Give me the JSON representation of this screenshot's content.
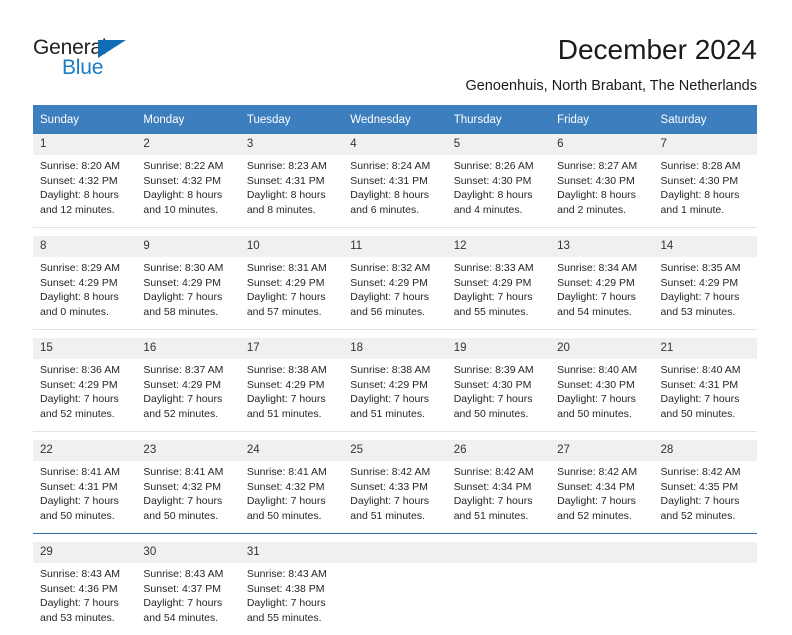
{
  "brand": {
    "name_dark": "General",
    "name_blue": "Blue",
    "accent_blue": "#1a7dc4",
    "triangle_blue": "#0f6cb5"
  },
  "header": {
    "title": "December 2024",
    "subtitle": "Genoenhuis, North Brabant, The Netherlands"
  },
  "calendar": {
    "header_bg": "#3d7ebf",
    "daynum_bg": "#f0f0f0",
    "weekdays": [
      "Sunday",
      "Monday",
      "Tuesday",
      "Wednesday",
      "Thursday",
      "Friday",
      "Saturday"
    ],
    "weeks": [
      {
        "days": [
          {
            "num": "1",
            "sunrise": "Sunrise: 8:20 AM",
            "sunset": "Sunset: 4:32 PM",
            "daylight1": "Daylight: 8 hours",
            "daylight2": "and 12 minutes."
          },
          {
            "num": "2",
            "sunrise": "Sunrise: 8:22 AM",
            "sunset": "Sunset: 4:32 PM",
            "daylight1": "Daylight: 8 hours",
            "daylight2": "and 10 minutes."
          },
          {
            "num": "3",
            "sunrise": "Sunrise: 8:23 AM",
            "sunset": "Sunset: 4:31 PM",
            "daylight1": "Daylight: 8 hours",
            "daylight2": "and 8 minutes."
          },
          {
            "num": "4",
            "sunrise": "Sunrise: 8:24 AM",
            "sunset": "Sunset: 4:31 PM",
            "daylight1": "Daylight: 8 hours",
            "daylight2": "and 6 minutes."
          },
          {
            "num": "5",
            "sunrise": "Sunrise: 8:26 AM",
            "sunset": "Sunset: 4:30 PM",
            "daylight1": "Daylight: 8 hours",
            "daylight2": "and 4 minutes."
          },
          {
            "num": "6",
            "sunrise": "Sunrise: 8:27 AM",
            "sunset": "Sunset: 4:30 PM",
            "daylight1": "Daylight: 8 hours",
            "daylight2": "and 2 minutes."
          },
          {
            "num": "7",
            "sunrise": "Sunrise: 8:28 AM",
            "sunset": "Sunset: 4:30 PM",
            "daylight1": "Daylight: 8 hours",
            "daylight2": "and 1 minute."
          }
        ]
      },
      {
        "days": [
          {
            "num": "8",
            "sunrise": "Sunrise: 8:29 AM",
            "sunset": "Sunset: 4:29 PM",
            "daylight1": "Daylight: 8 hours",
            "daylight2": "and 0 minutes."
          },
          {
            "num": "9",
            "sunrise": "Sunrise: 8:30 AM",
            "sunset": "Sunset: 4:29 PM",
            "daylight1": "Daylight: 7 hours",
            "daylight2": "and 58 minutes."
          },
          {
            "num": "10",
            "sunrise": "Sunrise: 8:31 AM",
            "sunset": "Sunset: 4:29 PM",
            "daylight1": "Daylight: 7 hours",
            "daylight2": "and 57 minutes."
          },
          {
            "num": "11",
            "sunrise": "Sunrise: 8:32 AM",
            "sunset": "Sunset: 4:29 PM",
            "daylight1": "Daylight: 7 hours",
            "daylight2": "and 56 minutes."
          },
          {
            "num": "12",
            "sunrise": "Sunrise: 8:33 AM",
            "sunset": "Sunset: 4:29 PM",
            "daylight1": "Daylight: 7 hours",
            "daylight2": "and 55 minutes."
          },
          {
            "num": "13",
            "sunrise": "Sunrise: 8:34 AM",
            "sunset": "Sunset: 4:29 PM",
            "daylight1": "Daylight: 7 hours",
            "daylight2": "and 54 minutes."
          },
          {
            "num": "14",
            "sunrise": "Sunrise: 8:35 AM",
            "sunset": "Sunset: 4:29 PM",
            "daylight1": "Daylight: 7 hours",
            "daylight2": "and 53 minutes."
          }
        ]
      },
      {
        "days": [
          {
            "num": "15",
            "sunrise": "Sunrise: 8:36 AM",
            "sunset": "Sunset: 4:29 PM",
            "daylight1": "Daylight: 7 hours",
            "daylight2": "and 52 minutes."
          },
          {
            "num": "16",
            "sunrise": "Sunrise: 8:37 AM",
            "sunset": "Sunset: 4:29 PM",
            "daylight1": "Daylight: 7 hours",
            "daylight2": "and 52 minutes."
          },
          {
            "num": "17",
            "sunrise": "Sunrise: 8:38 AM",
            "sunset": "Sunset: 4:29 PM",
            "daylight1": "Daylight: 7 hours",
            "daylight2": "and 51 minutes."
          },
          {
            "num": "18",
            "sunrise": "Sunrise: 8:38 AM",
            "sunset": "Sunset: 4:29 PM",
            "daylight1": "Daylight: 7 hours",
            "daylight2": "and 51 minutes."
          },
          {
            "num": "19",
            "sunrise": "Sunrise: 8:39 AM",
            "sunset": "Sunset: 4:30 PM",
            "daylight1": "Daylight: 7 hours",
            "daylight2": "and 50 minutes."
          },
          {
            "num": "20",
            "sunrise": "Sunrise: 8:40 AM",
            "sunset": "Sunset: 4:30 PM",
            "daylight1": "Daylight: 7 hours",
            "daylight2": "and 50 minutes."
          },
          {
            "num": "21",
            "sunrise": "Sunrise: 8:40 AM",
            "sunset": "Sunset: 4:31 PM",
            "daylight1": "Daylight: 7 hours",
            "daylight2": "and 50 minutes."
          }
        ]
      },
      {
        "days": [
          {
            "num": "22",
            "sunrise": "Sunrise: 8:41 AM",
            "sunset": "Sunset: 4:31 PM",
            "daylight1": "Daylight: 7 hours",
            "daylight2": "and 50 minutes."
          },
          {
            "num": "23",
            "sunrise": "Sunrise: 8:41 AM",
            "sunset": "Sunset: 4:32 PM",
            "daylight1": "Daylight: 7 hours",
            "daylight2": "and 50 minutes."
          },
          {
            "num": "24",
            "sunrise": "Sunrise: 8:41 AM",
            "sunset": "Sunset: 4:32 PM",
            "daylight1": "Daylight: 7 hours",
            "daylight2": "and 50 minutes."
          },
          {
            "num": "25",
            "sunrise": "Sunrise: 8:42 AM",
            "sunset": "Sunset: 4:33 PM",
            "daylight1": "Daylight: 7 hours",
            "daylight2": "and 51 minutes."
          },
          {
            "num": "26",
            "sunrise": "Sunrise: 8:42 AM",
            "sunset": "Sunset: 4:34 PM",
            "daylight1": "Daylight: 7 hours",
            "daylight2": "and 51 minutes."
          },
          {
            "num": "27",
            "sunrise": "Sunrise: 8:42 AM",
            "sunset": "Sunset: 4:34 PM",
            "daylight1": "Daylight: 7 hours",
            "daylight2": "and 52 minutes."
          },
          {
            "num": "28",
            "sunrise": "Sunrise: 8:42 AM",
            "sunset": "Sunset: 4:35 PM",
            "daylight1": "Daylight: 7 hours",
            "daylight2": "and 52 minutes."
          }
        ]
      },
      {
        "days": [
          {
            "num": "29",
            "sunrise": "Sunrise: 8:43 AM",
            "sunset": "Sunset: 4:36 PM",
            "daylight1": "Daylight: 7 hours",
            "daylight2": "and 53 minutes."
          },
          {
            "num": "30",
            "sunrise": "Sunrise: 8:43 AM",
            "sunset": "Sunset: 4:37 PM",
            "daylight1": "Daylight: 7 hours",
            "daylight2": "and 54 minutes."
          },
          {
            "num": "31",
            "sunrise": "Sunrise: 8:43 AM",
            "sunset": "Sunset: 4:38 PM",
            "daylight1": "Daylight: 7 hours",
            "daylight2": "and 55 minutes."
          },
          {
            "num": "",
            "sunrise": "",
            "sunset": "",
            "daylight1": "",
            "daylight2": ""
          },
          {
            "num": "",
            "sunrise": "",
            "sunset": "",
            "daylight1": "",
            "daylight2": ""
          },
          {
            "num": "",
            "sunrise": "",
            "sunset": "",
            "daylight1": "",
            "daylight2": ""
          },
          {
            "num": "",
            "sunrise": "",
            "sunset": "",
            "daylight1": "",
            "daylight2": ""
          }
        ]
      }
    ]
  }
}
